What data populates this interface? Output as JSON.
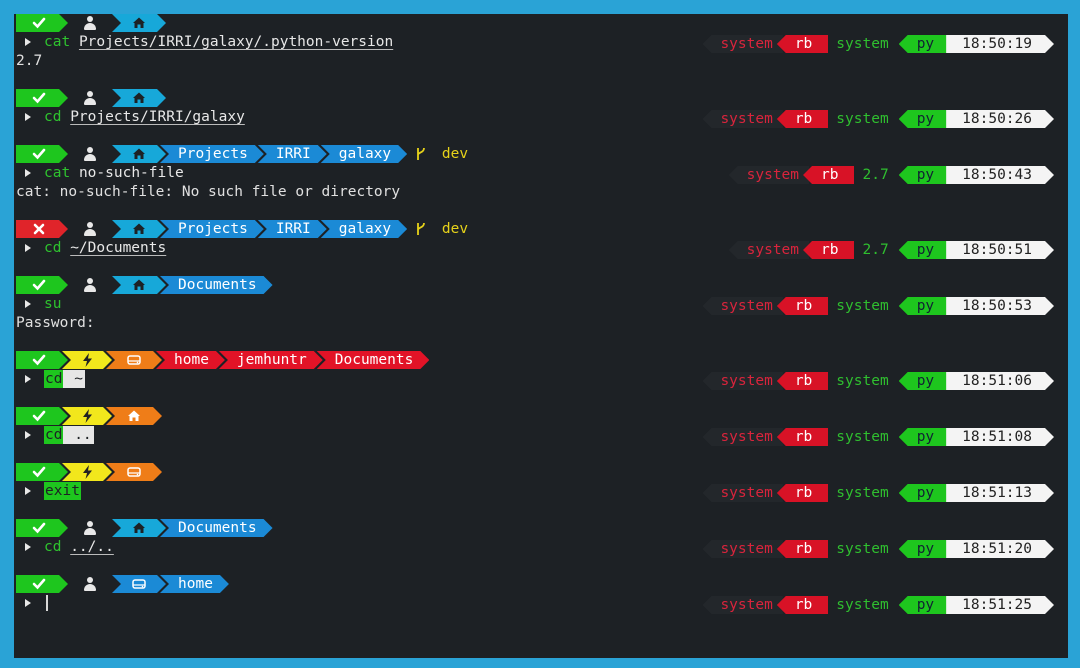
{
  "colors": {
    "bg": "#1d2125",
    "frame": "#2aa3d6",
    "green": "#1ec61e",
    "red": "#e0242a",
    "blue": "#1b8ad6",
    "yellow": "#f2e71c",
    "orange": "#ef7d18",
    "white": "#f4f4f4"
  },
  "icons": {
    "ok": "check-icon",
    "fail": "cross-icon",
    "user": "user-icon",
    "home": "home-icon",
    "root": "lightning-icon",
    "drive": "drive-icon",
    "branch": "git-branch-icon",
    "prompt": "triangle-right-icon"
  },
  "blocks": [
    {
      "status": "ok",
      "left": [
        {
          "t": "user"
        },
        {
          "t": "home"
        }
      ],
      "cmd": "cat",
      "arg": "Projects/IRRI/galaxy/.python-version",
      "out": "2.7",
      "right": {
        "sys": "system",
        "rb": "rb",
        "ver": "system",
        "py": "py",
        "time": "18:50:19"
      }
    },
    {
      "status": "ok",
      "left": [
        {
          "t": "user"
        },
        {
          "t": "home"
        }
      ],
      "cmd": "cd",
      "arg": "Projects/IRRI/galaxy",
      "right": {
        "sys": "system",
        "rb": "rb",
        "ver": "system",
        "py": "py",
        "time": "18:50:26"
      }
    },
    {
      "status": "ok",
      "left": [
        {
          "t": "user"
        },
        {
          "t": "home"
        }
      ],
      "path": [
        "Projects",
        "IRRI",
        "galaxy"
      ],
      "branch": "dev",
      "cmd": "cat",
      "arg": "no-such-file",
      "out": "cat: no-such-file: No such file or directory",
      "right": {
        "sys": "system",
        "rb": "rb",
        "ver": "2.7",
        "py": "py",
        "time": "18:50:43"
      }
    },
    {
      "status": "fail",
      "left": [
        {
          "t": "user"
        },
        {
          "t": "home"
        }
      ],
      "path": [
        "Projects",
        "IRRI",
        "galaxy"
      ],
      "branch": "dev",
      "cmd": "cd",
      "arg": "~/Documents",
      "right": {
        "sys": "system",
        "rb": "rb",
        "ver": "2.7",
        "py": "py",
        "time": "18:50:51"
      }
    },
    {
      "status": "ok",
      "left": [
        {
          "t": "user"
        },
        {
          "t": "home"
        }
      ],
      "path": [
        "Documents"
      ],
      "cmd": "su",
      "out": "Password:",
      "right": {
        "sys": "system",
        "rb": "rb",
        "ver": "system",
        "py": "py",
        "time": "18:50:53"
      }
    },
    {
      "status": "ok",
      "root": true,
      "drive": true,
      "rootpath": [
        "home",
        "jemhuntr",
        "Documents"
      ],
      "cmd": "cd",
      "arg": "~",
      "right": {
        "sys": "system",
        "rb": "rb",
        "ver": "system",
        "py": "py",
        "time": "18:51:06"
      }
    },
    {
      "status": "ok",
      "root": true,
      "homeorange": true,
      "cmd": "cd",
      "arg": "..",
      "right": {
        "sys": "system",
        "rb": "rb",
        "ver": "system",
        "py": "py",
        "time": "18:51:08"
      }
    },
    {
      "status": "ok",
      "root": true,
      "drive": true,
      "cmd": "exit",
      "right": {
        "sys": "system",
        "rb": "rb",
        "ver": "system",
        "py": "py",
        "time": "18:51:13"
      }
    },
    {
      "status": "ok",
      "left": [
        {
          "t": "user"
        },
        {
          "t": "home"
        }
      ],
      "path": [
        "Documents"
      ],
      "cmd": "cd",
      "arg": "../..",
      "right": {
        "sys": "system",
        "rb": "rb",
        "ver": "system",
        "py": "py",
        "time": "18:51:20"
      }
    },
    {
      "status": "ok",
      "left": [
        {
          "t": "user"
        }
      ],
      "drivehome": true,
      "path": [
        "home"
      ],
      "cmd": "",
      "right": {
        "sys": "system",
        "rb": "rb",
        "ver": "system",
        "py": "py",
        "time": "18:51:25"
      }
    }
  ]
}
